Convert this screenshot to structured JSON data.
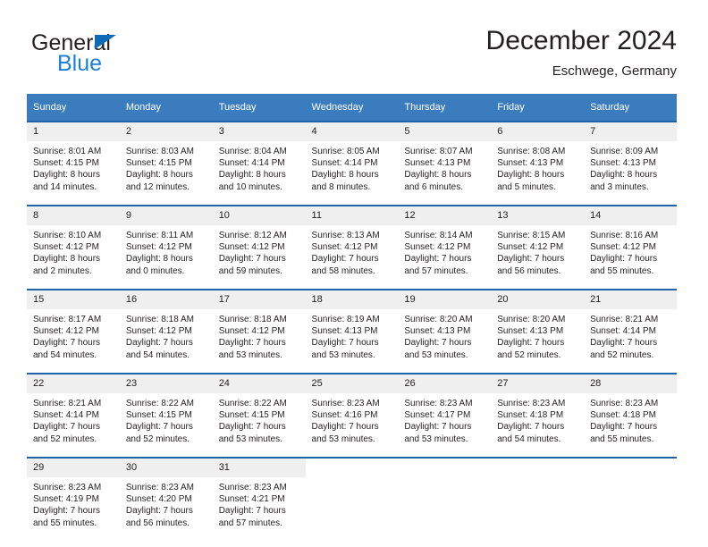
{
  "brand": {
    "name_top": "General",
    "name_bottom": "Blue",
    "triangle_color": "#0b6cb5",
    "blue_color": "#1b7fd4"
  },
  "header": {
    "month_title": "December 2024",
    "location": "Eschwege, Germany"
  },
  "theme": {
    "header_bg": "#3b7cbf",
    "row_separator": "#1f64a8",
    "daynum_bg": "#efefef",
    "text": "#231f20"
  },
  "calendar": {
    "weekdays": [
      "Sunday",
      "Monday",
      "Tuesday",
      "Wednesday",
      "Thursday",
      "Friday",
      "Saturday"
    ],
    "weeks": [
      [
        {
          "day": "1",
          "sunrise": "Sunrise: 8:01 AM",
          "sunset": "Sunset: 4:15 PM",
          "daylight_1": "Daylight: 8 hours",
          "daylight_2": "and 14 minutes."
        },
        {
          "day": "2",
          "sunrise": "Sunrise: 8:03 AM",
          "sunset": "Sunset: 4:15 PM",
          "daylight_1": "Daylight: 8 hours",
          "daylight_2": "and 12 minutes."
        },
        {
          "day": "3",
          "sunrise": "Sunrise: 8:04 AM",
          "sunset": "Sunset: 4:14 PM",
          "daylight_1": "Daylight: 8 hours",
          "daylight_2": "and 10 minutes."
        },
        {
          "day": "4",
          "sunrise": "Sunrise: 8:05 AM",
          "sunset": "Sunset: 4:14 PM",
          "daylight_1": "Daylight: 8 hours",
          "daylight_2": "and 8 minutes."
        },
        {
          "day": "5",
          "sunrise": "Sunrise: 8:07 AM",
          "sunset": "Sunset: 4:13 PM",
          "daylight_1": "Daylight: 8 hours",
          "daylight_2": "and 6 minutes."
        },
        {
          "day": "6",
          "sunrise": "Sunrise: 8:08 AM",
          "sunset": "Sunset: 4:13 PM",
          "daylight_1": "Daylight: 8 hours",
          "daylight_2": "and 5 minutes."
        },
        {
          "day": "7",
          "sunrise": "Sunrise: 8:09 AM",
          "sunset": "Sunset: 4:13 PM",
          "daylight_1": "Daylight: 8 hours",
          "daylight_2": "and 3 minutes."
        }
      ],
      [
        {
          "day": "8",
          "sunrise": "Sunrise: 8:10 AM",
          "sunset": "Sunset: 4:12 PM",
          "daylight_1": "Daylight: 8 hours",
          "daylight_2": "and 2 minutes."
        },
        {
          "day": "9",
          "sunrise": "Sunrise: 8:11 AM",
          "sunset": "Sunset: 4:12 PM",
          "daylight_1": "Daylight: 8 hours",
          "daylight_2": "and 0 minutes."
        },
        {
          "day": "10",
          "sunrise": "Sunrise: 8:12 AM",
          "sunset": "Sunset: 4:12 PM",
          "daylight_1": "Daylight: 7 hours",
          "daylight_2": "and 59 minutes."
        },
        {
          "day": "11",
          "sunrise": "Sunrise: 8:13 AM",
          "sunset": "Sunset: 4:12 PM",
          "daylight_1": "Daylight: 7 hours",
          "daylight_2": "and 58 minutes."
        },
        {
          "day": "12",
          "sunrise": "Sunrise: 8:14 AM",
          "sunset": "Sunset: 4:12 PM",
          "daylight_1": "Daylight: 7 hours",
          "daylight_2": "and 57 minutes."
        },
        {
          "day": "13",
          "sunrise": "Sunrise: 8:15 AM",
          "sunset": "Sunset: 4:12 PM",
          "daylight_1": "Daylight: 7 hours",
          "daylight_2": "and 56 minutes."
        },
        {
          "day": "14",
          "sunrise": "Sunrise: 8:16 AM",
          "sunset": "Sunset: 4:12 PM",
          "daylight_1": "Daylight: 7 hours",
          "daylight_2": "and 55 minutes."
        }
      ],
      [
        {
          "day": "15",
          "sunrise": "Sunrise: 8:17 AM",
          "sunset": "Sunset: 4:12 PM",
          "daylight_1": "Daylight: 7 hours",
          "daylight_2": "and 54 minutes."
        },
        {
          "day": "16",
          "sunrise": "Sunrise: 8:18 AM",
          "sunset": "Sunset: 4:12 PM",
          "daylight_1": "Daylight: 7 hours",
          "daylight_2": "and 54 minutes."
        },
        {
          "day": "17",
          "sunrise": "Sunrise: 8:18 AM",
          "sunset": "Sunset: 4:12 PM",
          "daylight_1": "Daylight: 7 hours",
          "daylight_2": "and 53 minutes."
        },
        {
          "day": "18",
          "sunrise": "Sunrise: 8:19 AM",
          "sunset": "Sunset: 4:13 PM",
          "daylight_1": "Daylight: 7 hours",
          "daylight_2": "and 53 minutes."
        },
        {
          "day": "19",
          "sunrise": "Sunrise: 8:20 AM",
          "sunset": "Sunset: 4:13 PM",
          "daylight_1": "Daylight: 7 hours",
          "daylight_2": "and 53 minutes."
        },
        {
          "day": "20",
          "sunrise": "Sunrise: 8:20 AM",
          "sunset": "Sunset: 4:13 PM",
          "daylight_1": "Daylight: 7 hours",
          "daylight_2": "and 52 minutes."
        },
        {
          "day": "21",
          "sunrise": "Sunrise: 8:21 AM",
          "sunset": "Sunset: 4:14 PM",
          "daylight_1": "Daylight: 7 hours",
          "daylight_2": "and 52 minutes."
        }
      ],
      [
        {
          "day": "22",
          "sunrise": "Sunrise: 8:21 AM",
          "sunset": "Sunset: 4:14 PM",
          "daylight_1": "Daylight: 7 hours",
          "daylight_2": "and 52 minutes."
        },
        {
          "day": "23",
          "sunrise": "Sunrise: 8:22 AM",
          "sunset": "Sunset: 4:15 PM",
          "daylight_1": "Daylight: 7 hours",
          "daylight_2": "and 52 minutes."
        },
        {
          "day": "24",
          "sunrise": "Sunrise: 8:22 AM",
          "sunset": "Sunset: 4:15 PM",
          "daylight_1": "Daylight: 7 hours",
          "daylight_2": "and 53 minutes."
        },
        {
          "day": "25",
          "sunrise": "Sunrise: 8:23 AM",
          "sunset": "Sunset: 4:16 PM",
          "daylight_1": "Daylight: 7 hours",
          "daylight_2": "and 53 minutes."
        },
        {
          "day": "26",
          "sunrise": "Sunrise: 8:23 AM",
          "sunset": "Sunset: 4:17 PM",
          "daylight_1": "Daylight: 7 hours",
          "daylight_2": "and 53 minutes."
        },
        {
          "day": "27",
          "sunrise": "Sunrise: 8:23 AM",
          "sunset": "Sunset: 4:18 PM",
          "daylight_1": "Daylight: 7 hours",
          "daylight_2": "and 54 minutes."
        },
        {
          "day": "28",
          "sunrise": "Sunrise: 8:23 AM",
          "sunset": "Sunset: 4:18 PM",
          "daylight_1": "Daylight: 7 hours",
          "daylight_2": "and 55 minutes."
        }
      ],
      [
        {
          "day": "29",
          "sunrise": "Sunrise: 8:23 AM",
          "sunset": "Sunset: 4:19 PM",
          "daylight_1": "Daylight: 7 hours",
          "daylight_2": "and 55 minutes."
        },
        {
          "day": "30",
          "sunrise": "Sunrise: 8:23 AM",
          "sunset": "Sunset: 4:20 PM",
          "daylight_1": "Daylight: 7 hours",
          "daylight_2": "and 56 minutes."
        },
        {
          "day": "31",
          "sunrise": "Sunrise: 8:23 AM",
          "sunset": "Sunset: 4:21 PM",
          "daylight_1": "Daylight: 7 hours",
          "daylight_2": "and 57 minutes."
        },
        {
          "day": "",
          "sunrise": "",
          "sunset": "",
          "daylight_1": "",
          "daylight_2": ""
        },
        {
          "day": "",
          "sunrise": "",
          "sunset": "",
          "daylight_1": "",
          "daylight_2": ""
        },
        {
          "day": "",
          "sunrise": "",
          "sunset": "",
          "daylight_1": "",
          "daylight_2": ""
        },
        {
          "day": "",
          "sunrise": "",
          "sunset": "",
          "daylight_1": "",
          "daylight_2": ""
        }
      ]
    ]
  }
}
